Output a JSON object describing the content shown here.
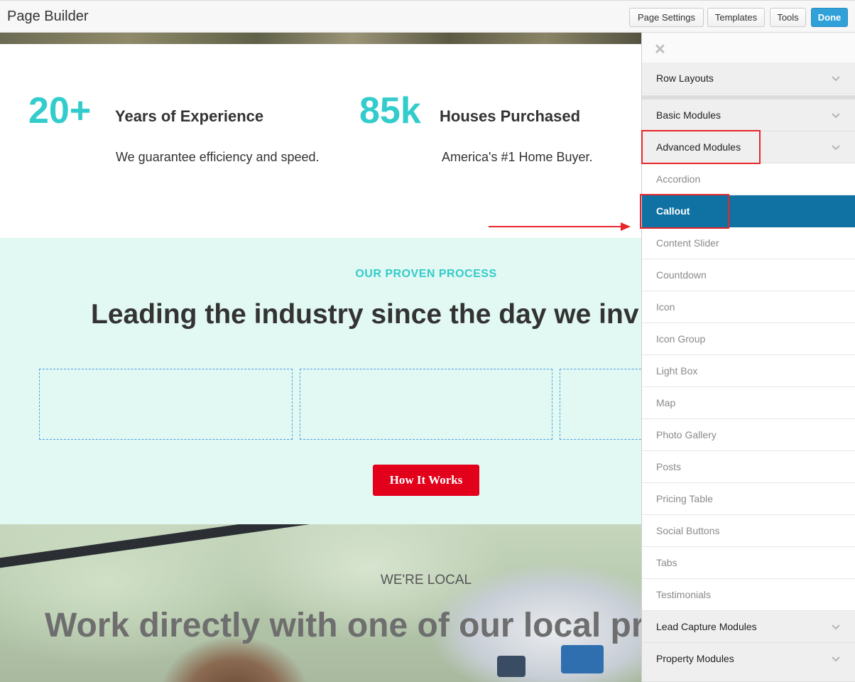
{
  "app": {
    "title": "Page Builder"
  },
  "toolbar": {
    "page_settings": "Page Settings",
    "templates": "Templates",
    "tools": "Tools",
    "done": "Done",
    "done_color": "#2fa0d8"
  },
  "stats": [
    {
      "number": "20+",
      "label": "Years of Experience",
      "desc": "We guarantee efficiency and speed."
    },
    {
      "number": "85k",
      "label": "Houses Purchased",
      "desc": "America's #1 Home Buyer."
    }
  ],
  "process": {
    "eyebrow": "OUR PROVEN PROCESS",
    "heading": "Leading the industry since the day we inv",
    "button": "How It Works"
  },
  "local": {
    "eyebrow": "WE'RE LOCAL",
    "heading": "Work directly with one of our local pro"
  },
  "panel": {
    "close_icon": "close-icon",
    "sections": {
      "row_layouts": "Row Layouts",
      "basic_modules": "Basic Modules",
      "advanced_modules": "Advanced Modules",
      "lead_capture": "Lead Capture Modules",
      "property_modules": "Property Modules"
    },
    "advanced_items": [
      "Accordion",
      "Callout",
      "Content Slider",
      "Countdown",
      "Icon",
      "Icon Group",
      "Light Box",
      "Map",
      "Photo Gallery",
      "Posts",
      "Pricing Table",
      "Social Buttons",
      "Tabs",
      "Testimonials"
    ],
    "selected_item": "Callout",
    "selected_color": "#0f72a3"
  },
  "colors": {
    "accent_teal": "#33cccc",
    "cta_red": "#e2001a",
    "annotation_red": "#e8262a"
  }
}
